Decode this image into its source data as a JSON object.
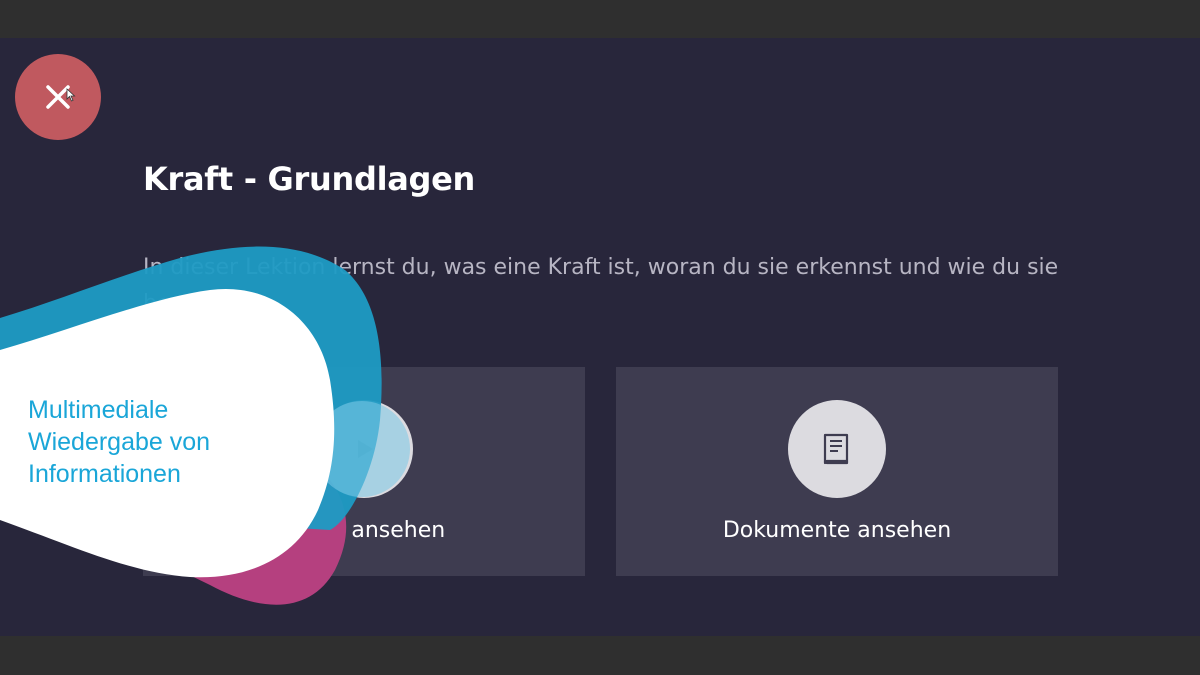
{
  "lesson": {
    "title": "Kraft - Grundlagen",
    "description": "In dieser Lektion lernst du, was eine Kraft ist, woran du sie erkennst und wie du sie berechnest."
  },
  "cards": {
    "video": {
      "label": "Video ansehen",
      "icon": "play-icon"
    },
    "documents": {
      "label": "Dokumente ansehen",
      "icon": "book-icon"
    }
  },
  "close_button": {
    "icon": "close-icon"
  },
  "overlay": {
    "lines": [
      "Multimediale",
      "Wiedergabe von",
      "Informationen"
    ]
  },
  "colors": {
    "background": "#28263b",
    "card": "#3e3c50",
    "close": "#c0595f",
    "overlay_text": "#1aa6d8",
    "blob_blue": "#1e9bc4",
    "blob_magenta": "#b5407f"
  }
}
